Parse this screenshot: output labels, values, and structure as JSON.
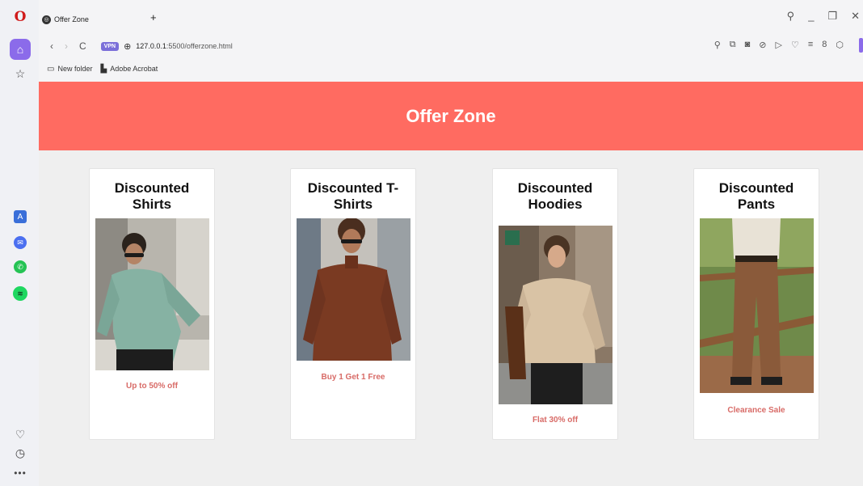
{
  "browser": {
    "tab_title": "Offer Zone",
    "new_tab_label": "+",
    "url_host": "127.0.0.1",
    "url_path": ":5500/offerzone.html",
    "vpn_label": "VPN"
  },
  "bookmarks": [
    {
      "label": "New folder"
    },
    {
      "label": "Adobe Acrobat"
    }
  ],
  "page": {
    "title": "Offer Zone",
    "cards": [
      {
        "title": "Discounted Shirts",
        "offer": "Up to 50% off"
      },
      {
        "title": "Discounted T-Shirts",
        "offer": "Buy 1 Get 1 Free"
      },
      {
        "title": "Discounted Hoodies",
        "offer": "Flat 30% off"
      },
      {
        "title": "Discounted Pants",
        "offer": "Clearance Sale"
      }
    ]
  },
  "colors": {
    "header": "#ff6b61",
    "offer_text": "#d86b67",
    "opera_accent": "#8b6bea"
  }
}
